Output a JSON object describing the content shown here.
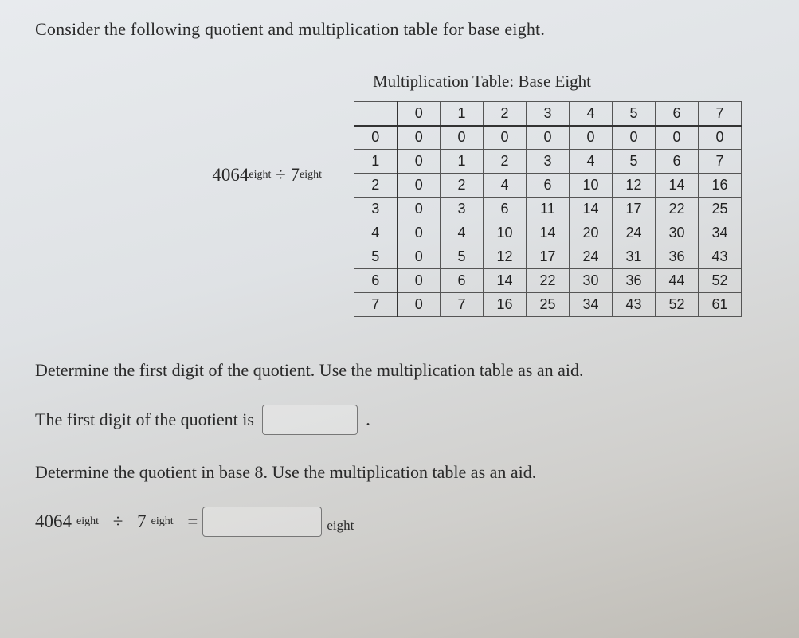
{
  "intro": "Consider the following quotient and multiplication table for base eight.",
  "expression": {
    "lhs_num": "4064",
    "lhs_base": "eight",
    "op": "÷",
    "rhs_num": "7",
    "rhs_base": "eight"
  },
  "table": {
    "title": "Multiplication Table: Base Eight",
    "headers": [
      "0",
      "1",
      "2",
      "3",
      "4",
      "5",
      "6",
      "7"
    ],
    "rows": [
      {
        "hdr": "0",
        "cells": [
          "0",
          "0",
          "0",
          "0",
          "0",
          "0",
          "0",
          "0"
        ]
      },
      {
        "hdr": "1",
        "cells": [
          "0",
          "1",
          "2",
          "3",
          "4",
          "5",
          "6",
          "7"
        ]
      },
      {
        "hdr": "2",
        "cells": [
          "0",
          "2",
          "4",
          "6",
          "10",
          "12",
          "14",
          "16"
        ]
      },
      {
        "hdr": "3",
        "cells": [
          "0",
          "3",
          "6",
          "11",
          "14",
          "17",
          "22",
          "25"
        ]
      },
      {
        "hdr": "4",
        "cells": [
          "0",
          "4",
          "10",
          "14",
          "20",
          "24",
          "30",
          "34"
        ]
      },
      {
        "hdr": "5",
        "cells": [
          "0",
          "5",
          "12",
          "17",
          "24",
          "31",
          "36",
          "43"
        ]
      },
      {
        "hdr": "6",
        "cells": [
          "0",
          "6",
          "14",
          "22",
          "30",
          "36",
          "44",
          "52"
        ]
      },
      {
        "hdr": "7",
        "cells": [
          "0",
          "7",
          "16",
          "25",
          "34",
          "43",
          "52",
          "61"
        ]
      }
    ]
  },
  "q1": "Determine the first digit of the quotient. Use the multiplication table as an aid.",
  "ans1_label": "The first digit of the quotient is",
  "q2": "Determine the quotient in base 8. Use the multiplication table as an aid.",
  "final": {
    "lhs_num": "4064",
    "lhs_base": "eight",
    "op": "÷",
    "rhs_num": "7",
    "rhs_base": "eight",
    "eq": "=",
    "unit": "eight"
  }
}
